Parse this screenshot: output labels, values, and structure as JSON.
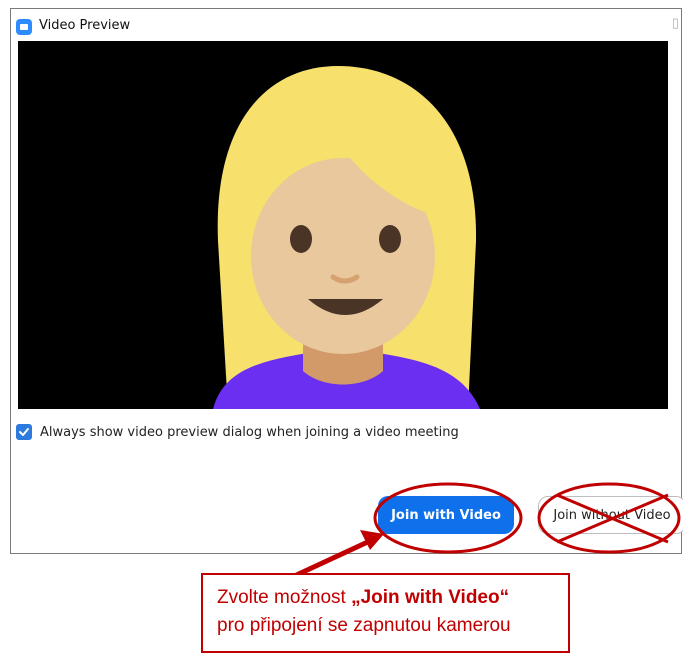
{
  "window": {
    "title": "Video Preview"
  },
  "options": {
    "always_show_label": "Always show video preview dialog when joining a video meeting",
    "always_show_checked": true
  },
  "buttons": {
    "join_with_video": "Join with Video",
    "join_without_video": "Join without Video"
  },
  "callout": {
    "line1_prefix": "Zvolte možnost ",
    "line1_highlight": "„Join with Video“",
    "line2": "pro připojení se zapnutou kamerou"
  },
  "colors": {
    "primary_button": "#0e71eb",
    "annotation_red": "#c00000",
    "checkbox": "#2d7bdc",
    "hair": "#f7e06c",
    "skin": "#e8c89c",
    "shirt": "#6a2ff0"
  },
  "icons": {
    "app": "zoom-camera-icon",
    "checkbox": "checkmark-icon",
    "avatar": "woman-emoji-avatar"
  }
}
